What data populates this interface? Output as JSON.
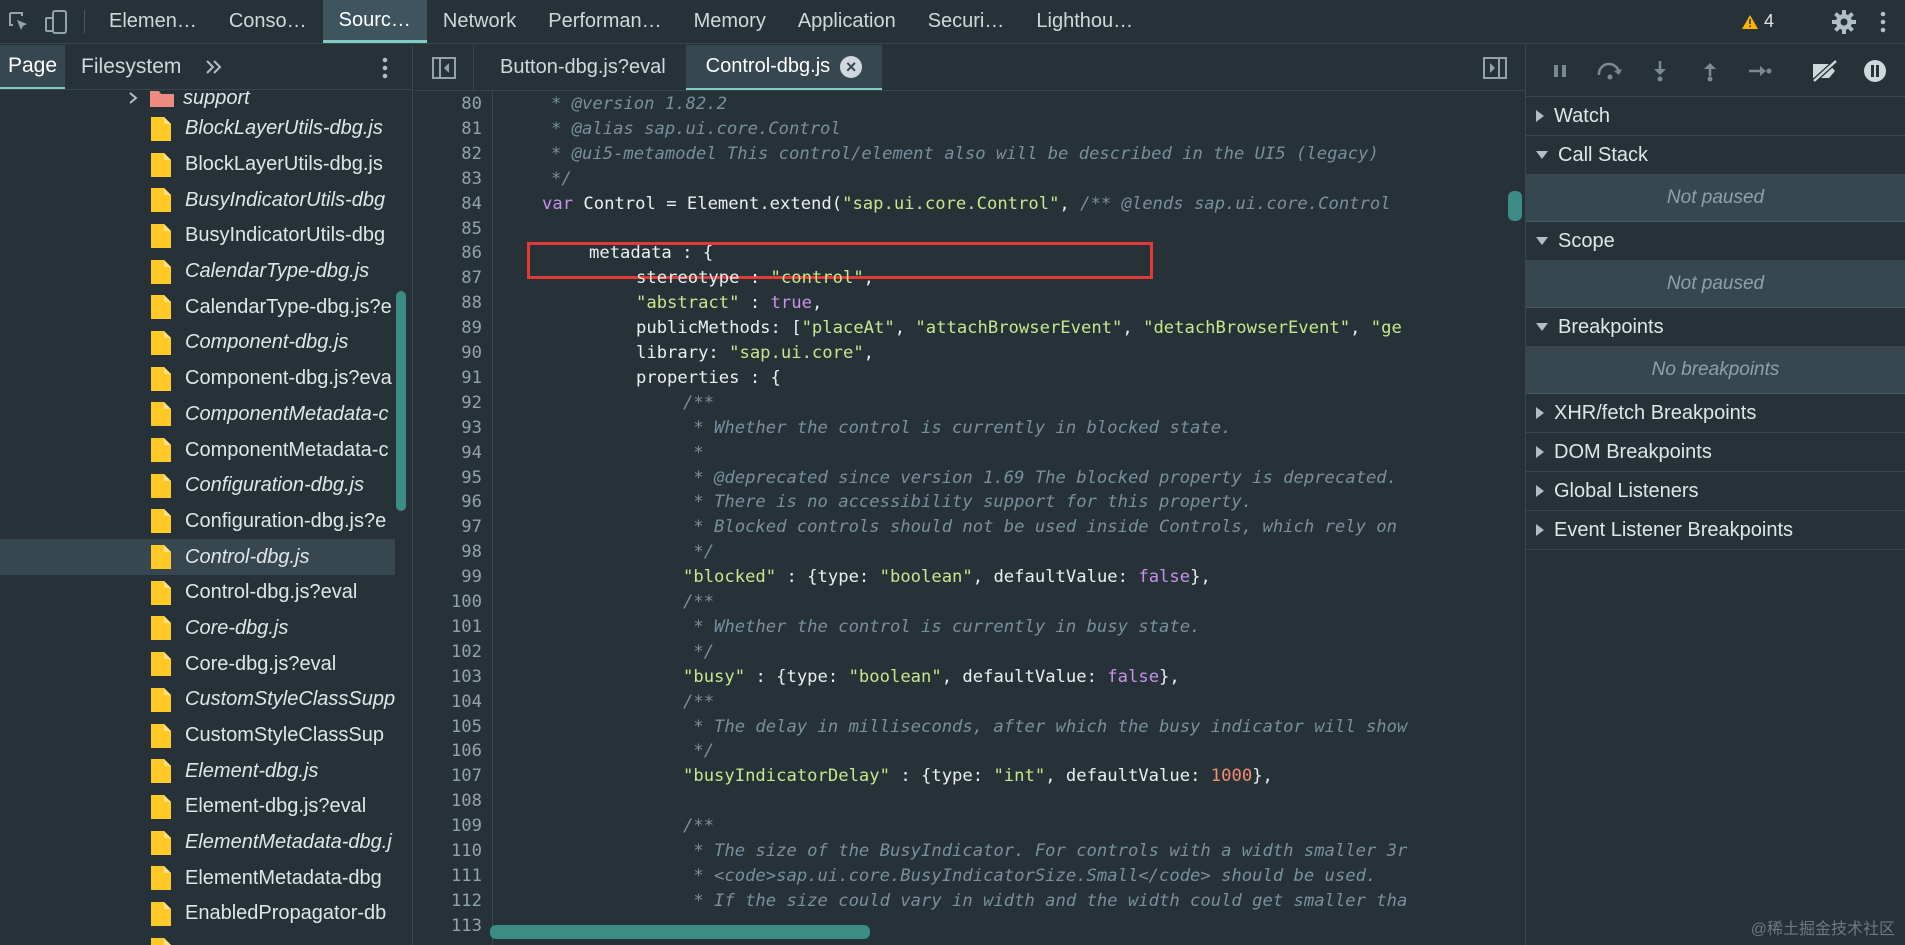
{
  "toolbar": {
    "tabs": [
      "Elemen…",
      "Conso…",
      "Sourc…",
      "Network",
      "Performan…",
      "Memory",
      "Application",
      "Securi…",
      "Lighthou…"
    ],
    "active_tab": "Sourc…",
    "warnings_count": "4"
  },
  "navigator": {
    "tabs": [
      "Page",
      "Filesystem"
    ],
    "folder": "support",
    "files": [
      {
        "name": "BlockLayerUtils-dbg.js",
        "italic": true
      },
      {
        "name": "BlockLayerUtils-dbg.js",
        "italic": false
      },
      {
        "name": "BusyIndicatorUtils-dbg",
        "italic": true
      },
      {
        "name": "BusyIndicatorUtils-dbg",
        "italic": false
      },
      {
        "name": "CalendarType-dbg.js",
        "italic": true
      },
      {
        "name": "CalendarType-dbg.js?e",
        "italic": false
      },
      {
        "name": "Component-dbg.js",
        "italic": true
      },
      {
        "name": "Component-dbg.js?eva",
        "italic": false
      },
      {
        "name": "ComponentMetadata-c",
        "italic": true
      },
      {
        "name": "ComponentMetadata-c",
        "italic": false
      },
      {
        "name": "Configuration-dbg.js",
        "italic": true
      },
      {
        "name": "Configuration-dbg.js?e",
        "italic": false
      },
      {
        "name": "Control-dbg.js",
        "italic": true,
        "selected": true
      },
      {
        "name": "Control-dbg.js?eval",
        "italic": false
      },
      {
        "name": "Core-dbg.js",
        "italic": true
      },
      {
        "name": "Core-dbg.js?eval",
        "italic": false
      },
      {
        "name": "CustomStyleClassSupp",
        "italic": true
      },
      {
        "name": "CustomStyleClassSup",
        "italic": false
      },
      {
        "name": "Element-dbg.js",
        "italic": true
      },
      {
        "name": "Element-dbg.js?eval",
        "italic": false
      },
      {
        "name": "ElementMetadata-dbg.j",
        "italic": true
      },
      {
        "name": "ElementMetadata-dbg",
        "italic": false
      },
      {
        "name": "EnabledPropagator-db",
        "italic": false
      },
      {
        "name": "",
        "italic": false
      }
    ]
  },
  "editor": {
    "tabs": [
      "Button-dbg.js?eval",
      "Control-dbg.js"
    ],
    "active_tab": "Control-dbg.js",
    "lines": [
      {
        "n": "80",
        "t": [
          [
            "cm",
            "* @version 1.82.2"
          ]
        ],
        "i": 1
      },
      {
        "n": "81",
        "t": [
          [
            "cm",
            "* @alias sap.ui.core.Control"
          ]
        ],
        "i": 1
      },
      {
        "n": "82",
        "t": [
          [
            "cm",
            "* @ui5-metamodel This control/element also will be described in the UI5 (legacy)"
          ]
        ],
        "i": 1
      },
      {
        "n": "83",
        "t": [
          [
            "cm",
            "*/"
          ]
        ],
        "i": 1
      },
      {
        "n": "84",
        "t": [
          [
            "kw",
            "var "
          ],
          [
            "pl",
            "Control = Element.extend("
          ],
          [
            "st",
            "\"sap.ui.core.Control\""
          ],
          [
            "pl",
            ", "
          ],
          [
            "cm",
            "/** @lends sap.ui.core.Control"
          ]
        ],
        "i": 0
      },
      {
        "n": "85",
        "t": [],
        "i": 0
      },
      {
        "n": "86",
        "t": [
          [
            "pl",
            "metadata : {"
          ]
        ],
        "i": 1
      },
      {
        "n": "87",
        "t": [
          [
            "pl",
            "stereotype : "
          ],
          [
            "st",
            "\"control\""
          ],
          [
            "pl",
            ","
          ]
        ],
        "i": 2
      },
      {
        "n": "88",
        "t": [
          [
            "st",
            "\"abstract\""
          ],
          [
            "pl",
            " : "
          ],
          [
            "bo",
            "true"
          ],
          [
            "pl",
            ","
          ]
        ],
        "i": 2
      },
      {
        "n": "89",
        "t": [
          [
            "pl",
            "publicMethods: ["
          ],
          [
            "st",
            "\"placeAt\""
          ],
          [
            "pl",
            ", "
          ],
          [
            "st",
            "\"attachBrowserEvent\""
          ],
          [
            "pl",
            ", "
          ],
          [
            "st",
            "\"detachBrowserEvent\""
          ],
          [
            "pl",
            ", "
          ],
          [
            "st",
            "\"ge"
          ]
        ],
        "i": 2
      },
      {
        "n": "90",
        "t": [
          [
            "pl",
            "library: "
          ],
          [
            "st",
            "\"sap.ui.core\""
          ],
          [
            "pl",
            ","
          ]
        ],
        "i": 2
      },
      {
        "n": "91",
        "t": [
          [
            "pl",
            "properties : {"
          ]
        ],
        "i": 2
      },
      {
        "n": "92",
        "t": [
          [
            "cm",
            "/**"
          ]
        ],
        "i": 3
      },
      {
        "n": "93",
        "t": [
          [
            "cm",
            " * Whether the control is currently in blocked state."
          ]
        ],
        "i": 3
      },
      {
        "n": "94",
        "t": [
          [
            "cm",
            " *"
          ]
        ],
        "i": 3
      },
      {
        "n": "95",
        "t": [
          [
            "cm",
            " * @deprecated since version 1.69 The blocked property is deprecated."
          ]
        ],
        "i": 3
      },
      {
        "n": "96",
        "t": [
          [
            "cm",
            " * There is no accessibility support for this property."
          ]
        ],
        "i": 3
      },
      {
        "n": "97",
        "t": [
          [
            "cm",
            " * Blocked controls should not be used inside Controls, which rely on"
          ]
        ],
        "i": 3
      },
      {
        "n": "98",
        "t": [
          [
            "cm",
            " */"
          ]
        ],
        "i": 3
      },
      {
        "n": "99",
        "t": [
          [
            "st",
            "\"blocked\""
          ],
          [
            "pl",
            " : {type: "
          ],
          [
            "st",
            "\"boolean\""
          ],
          [
            "pl",
            ", defaultValue: "
          ],
          [
            "bo",
            "false"
          ],
          [
            "pl",
            "},"
          ]
        ],
        "i": 3
      },
      {
        "n": "100",
        "t": [
          [
            "cm",
            "/**"
          ]
        ],
        "i": 3
      },
      {
        "n": "101",
        "t": [
          [
            "cm",
            " * Whether the control is currently in busy state."
          ]
        ],
        "i": 3
      },
      {
        "n": "102",
        "t": [
          [
            "cm",
            " */"
          ]
        ],
        "i": 3
      },
      {
        "n": "103",
        "t": [
          [
            "st",
            "\"busy\""
          ],
          [
            "pl",
            " : {type: "
          ],
          [
            "st",
            "\"boolean\""
          ],
          [
            "pl",
            ", defaultValue: "
          ],
          [
            "bo",
            "false"
          ],
          [
            "pl",
            "},"
          ]
        ],
        "i": 3
      },
      {
        "n": "104",
        "t": [
          [
            "cm",
            "/**"
          ]
        ],
        "i": 3
      },
      {
        "n": "105",
        "t": [
          [
            "cm",
            " * The delay in milliseconds, after which the busy indicator will show"
          ]
        ],
        "i": 3
      },
      {
        "n": "106",
        "t": [
          [
            "cm",
            " */"
          ]
        ],
        "i": 3
      },
      {
        "n": "107",
        "t": [
          [
            "st",
            "\"busyIndicatorDelay\""
          ],
          [
            "pl",
            " : {type: "
          ],
          [
            "st",
            "\"int\""
          ],
          [
            "pl",
            ", defaultValue: "
          ],
          [
            "nu",
            "1000"
          ],
          [
            "pl",
            "},"
          ]
        ],
        "i": 3
      },
      {
        "n": "108",
        "t": [],
        "i": 0
      },
      {
        "n": "109",
        "t": [
          [
            "cm",
            "/**"
          ]
        ],
        "i": 3
      },
      {
        "n": "110",
        "t": [
          [
            "cm",
            " * The size of the BusyIndicator. For controls with a width smaller 3r"
          ]
        ],
        "i": 3
      },
      {
        "n": "111",
        "t": [
          [
            "cm",
            " * <code>sap.ui.core.BusyIndicatorSize.Small</code> should be used."
          ]
        ],
        "i": 3
      },
      {
        "n": "112",
        "t": [
          [
            "cm",
            " * If the size could vary in width and the width could get smaller tha"
          ]
        ],
        "i": 3
      },
      {
        "n": "113",
        "t": [],
        "i": 0
      }
    ]
  },
  "debugger": {
    "sections": [
      {
        "label": "Watch",
        "open": false,
        "empty": ""
      },
      {
        "label": "Call Stack",
        "open": true,
        "empty": "Not paused"
      },
      {
        "label": "Scope",
        "open": true,
        "empty": "Not paused"
      },
      {
        "label": "Breakpoints",
        "open": true,
        "empty": "No breakpoints"
      },
      {
        "label": "XHR/fetch Breakpoints",
        "open": false,
        "empty": ""
      },
      {
        "label": "DOM Breakpoints",
        "open": false,
        "empty": ""
      },
      {
        "label": "Global Listeners",
        "open": false,
        "empty": ""
      },
      {
        "label": "Event Listener Breakpoints",
        "open": false,
        "empty": ""
      }
    ]
  },
  "watermark": "@稀土掘金技术社区",
  "colors": {
    "accent": "#80cbc4",
    "highlight_border": "#e53935",
    "folder": "#ef8a80",
    "file": "#ffca28"
  }
}
